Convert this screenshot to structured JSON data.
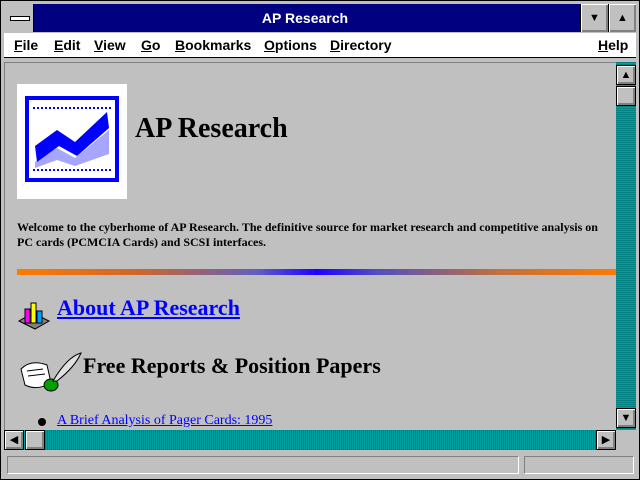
{
  "window": {
    "title": "AP Research"
  },
  "menu": {
    "file": "File",
    "edit": "Edit",
    "view": "View",
    "go": "Go",
    "bookmarks": "Bookmarks",
    "options": "Options",
    "directory": "Directory",
    "help": "Help"
  },
  "page": {
    "heading": "AP Research",
    "welcome": "Welcome to the cyberhome of AP Research. The definitive source for market research and competitive analysis on PC cards (PCMCIA Cards) and SCSI interfaces.",
    "about_link": "About AP Research",
    "reports_heading": "Free Reports & Position Papers",
    "reports": [
      "A Brief Analysis of Pager Cards: 1995"
    ]
  },
  "colors": {
    "titlebar": "#000080",
    "link": "#0000ff",
    "scrollbar": "#008080",
    "background": "#c0c0c0"
  },
  "icons": {
    "system_menu": "dash-icon",
    "minimize": "triangle-down-icon",
    "maximize": "triangle-up-icon",
    "logo": "rising-chart-logo",
    "about": "bar-chart-icon",
    "reports": "scroll-quill-icon"
  }
}
